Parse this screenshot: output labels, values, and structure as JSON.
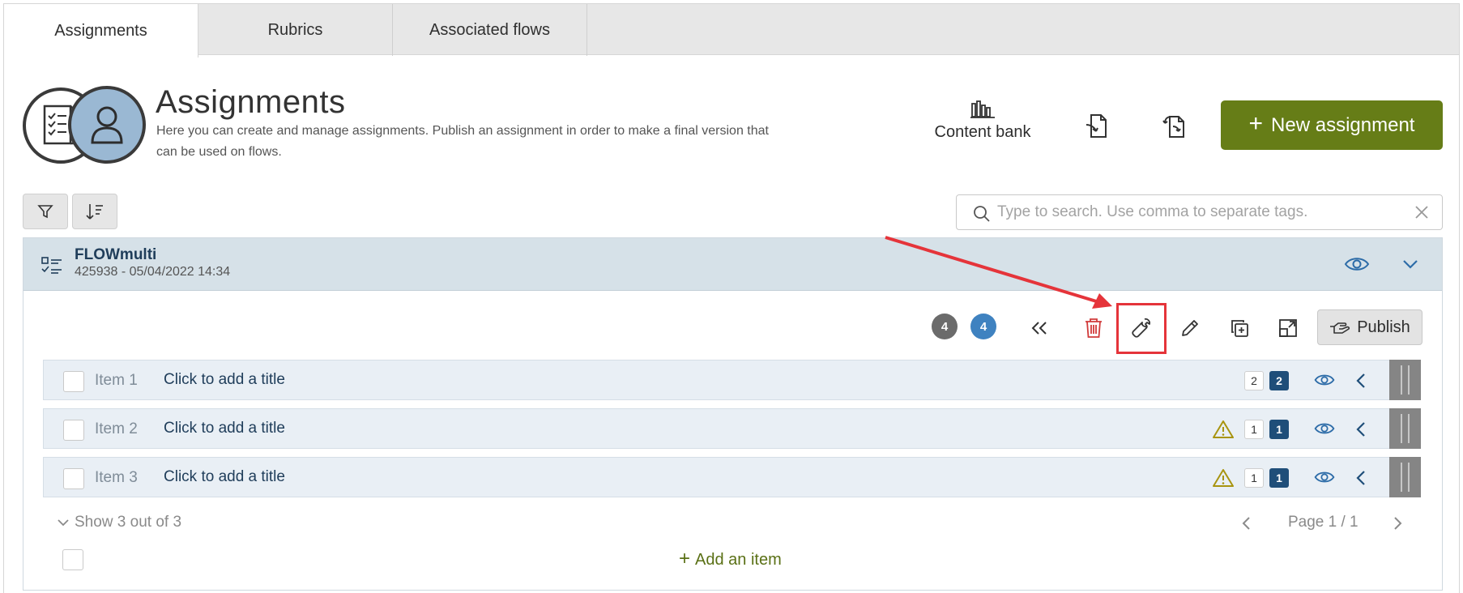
{
  "tabs": [
    {
      "label": "Assignments",
      "active": true
    },
    {
      "label": "Rubrics",
      "active": false
    },
    {
      "label": "Associated flows",
      "active": false
    }
  ],
  "header": {
    "title": "Assignments",
    "description": "Here you can create and manage assignments. Publish an assignment in order to make a final version that can be used on flows.",
    "content_bank_label": "Content bank",
    "new_assignment_label": "New assignment"
  },
  "search": {
    "placeholder": "Type to search. Use comma to separate tags."
  },
  "flow": {
    "name": "FLOWmulti",
    "meta": "425938 - 05/04/2022 14:34",
    "count_grey": "4",
    "count_blue": "4",
    "publish_label": "Publish",
    "items": [
      {
        "label": "Item 1",
        "title": "Click to add a title",
        "warning": false,
        "count_light": "2",
        "count_dark": "2"
      },
      {
        "label": "Item 2",
        "title": "Click to add a title",
        "warning": true,
        "count_light": "1",
        "count_dark": "1"
      },
      {
        "label": "Item 3",
        "title": "Click to add a title",
        "warning": true,
        "count_light": "1",
        "count_dark": "1"
      }
    ],
    "show_count": "Show 3 out of 3",
    "page_label": "Page 1 / 1",
    "add_item_label": "Add an item"
  },
  "colors": {
    "primary_green": "#667d17",
    "card_header": "#d6e1e8",
    "item_row": "#e9eff5",
    "highlight_red": "#e5343a",
    "badge_blue": "#3f82c0"
  },
  "icons": [
    "filter-icon",
    "sort-icon",
    "search-icon",
    "clear-icon",
    "content-bank-icon",
    "import-icon",
    "sync-icon",
    "checklist-icon",
    "eye-icon",
    "chevron-down-icon",
    "collapse-all-icon",
    "trash-icon",
    "wrench-icon",
    "pencil-icon",
    "duplicate-icon",
    "expand-icon",
    "publish-hand-icon",
    "warning-icon",
    "chevron-left-icon",
    "drag-handle-icon"
  ]
}
